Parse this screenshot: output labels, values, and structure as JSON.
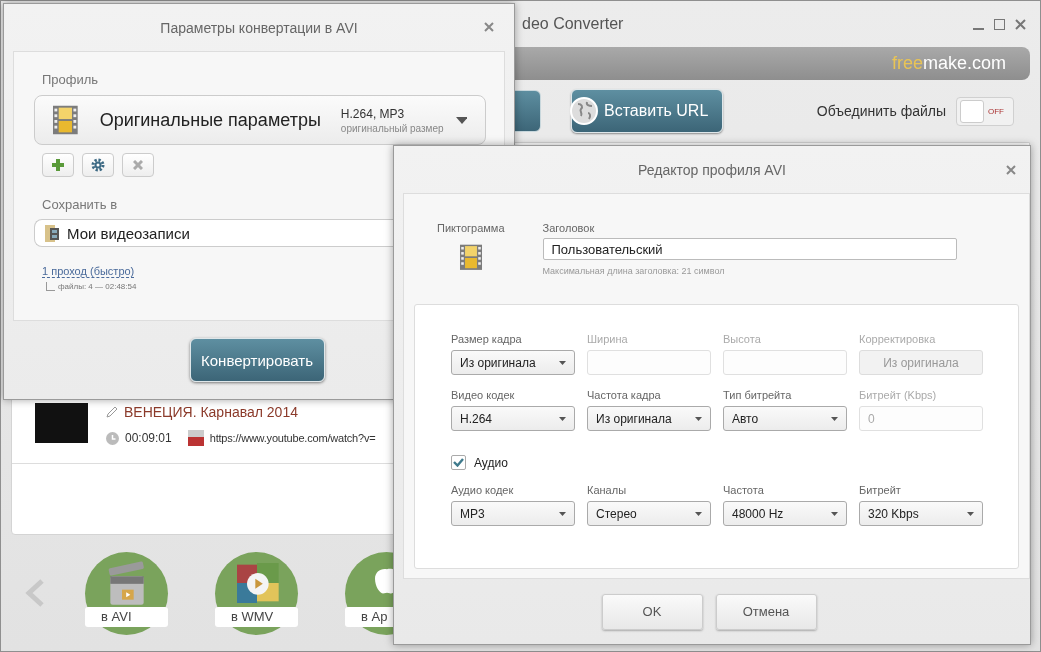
{
  "main_window": {
    "title": "deo Converter",
    "logo": [
      "free",
      "make.com"
    ],
    "toolbar": {
      "paste_url_button": "Вставить URL",
      "merge_label": "Объединить файлы",
      "merge_toggle": {
        "on": false,
        "text": "OFF"
      }
    },
    "files": [
      {
        "title": "ВЕНЕЦИЯ. Карнавал 2014",
        "duration": "00:09:01",
        "source": "https://www.youtube.com/watch?v="
      }
    ],
    "formats": [
      {
        "label": "в AVI",
        "kind": "avi"
      },
      {
        "label": "в WMV",
        "kind": "wmv"
      },
      {
        "label": "в Ap",
        "kind": "apple"
      }
    ]
  },
  "convert_dialog": {
    "title": "Параметры конвертации в AVI",
    "profile_label": "Профиль",
    "profile": {
      "name": "Оригинальные параметры",
      "codecs": "H.264, MP3",
      "size": "оригинальный размер"
    },
    "save_label": "Сохранить в",
    "save_to": "Мои видеозаписи",
    "pass_link": "1 проход (быстро)",
    "summary": "файлы: 4 — 02:48:54",
    "convert_button": "Конвертировать"
  },
  "profile_editor": {
    "title": "Редактор профиля AVI",
    "icon_label": "Пиктограмма",
    "name_label": "Заголовок",
    "name_value": "Пользовательский",
    "name_hint": "Максимальная длина заголовка: 21 символ",
    "video_fields": [
      {
        "label": "Размер кадра",
        "kind": "select",
        "value": "Из оригинала",
        "disabled": false
      },
      {
        "label": "Ширина",
        "kind": "input",
        "disabled": true
      },
      {
        "label": "Высота",
        "kind": "input",
        "disabled": true
      },
      {
        "label": "Корректировка",
        "kind": "button",
        "value": "Из оригинала",
        "disabled": true
      },
      {
        "label": "Видео кодек",
        "kind": "select",
        "value": "H.264",
        "disabled": false
      },
      {
        "label": "Частота кадра",
        "kind": "select",
        "value": "Из оригинала",
        "disabled": false
      },
      {
        "label": "Тип битрейта",
        "kind": "select",
        "value": "Авто",
        "disabled": false
      },
      {
        "label": "Битрейт (Kbps)",
        "kind": "input",
        "value": "0",
        "disabled": true
      }
    ],
    "audio": {
      "label": "Аудио",
      "checked": true
    },
    "audio_fields": [
      {
        "label": "Аудио кодек",
        "kind": "select",
        "value": "MP3",
        "disabled": false
      },
      {
        "label": "Каналы",
        "kind": "select",
        "value": "Стерео",
        "disabled": false
      },
      {
        "label": "Частота",
        "kind": "select",
        "value": "48000 Hz",
        "disabled": false
      },
      {
        "label": "Битрейт",
        "kind": "select",
        "value": "320 Kbps",
        "disabled": false
      }
    ],
    "buttons": [
      "OK",
      "Отмена"
    ]
  }
}
